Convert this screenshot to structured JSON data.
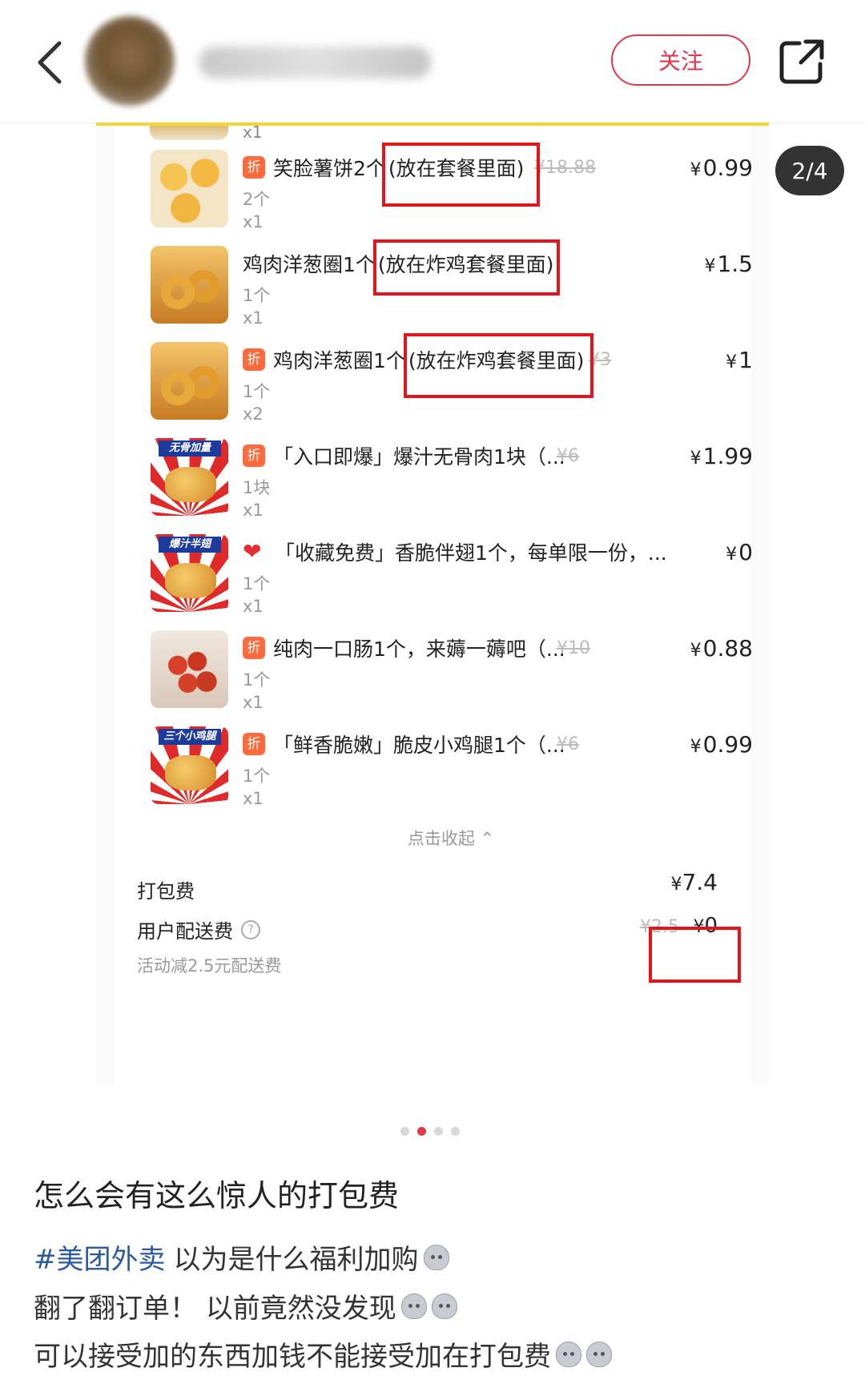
{
  "header": {
    "follow_label": "关注",
    "page_counter": "2/4"
  },
  "order": {
    "top_partial_qty": "x1",
    "items": [
      {
        "badge": "折",
        "name": "笑脸薯饼2个",
        "note": "(放在套餐里面)",
        "spec": "2个",
        "qty": "x1",
        "orig_price": "¥18.88",
        "price": "0.99"
      },
      {
        "badge": "",
        "name": "鸡肉洋葱圈1个",
        "note": "(放在炸鸡套餐里面)",
        "spec": "1个",
        "qty": "x1",
        "orig_price": "",
        "price": "1.5"
      },
      {
        "badge": "折",
        "name": "鸡肉洋葱圈1个",
        "note": "(放在炸鸡套餐里面)",
        "spec": "1个",
        "qty": "x2",
        "orig_price": "¥3",
        "price": "1"
      },
      {
        "badge": "折",
        "name": "「入口即爆」爆汁无骨肉1块（...",
        "note": "",
        "spec": "1块",
        "qty": "x1",
        "orig_price": "¥6",
        "price": "1.99",
        "thumb_tag": "无骨加量"
      },
      {
        "badge": "heart",
        "name": "「收藏免费」香脆伴翅1个，每单限一份，...",
        "note": "",
        "spec": "1个",
        "qty": "x1",
        "orig_price": "",
        "price": "0",
        "thumb_tag": "爆汁半翅"
      },
      {
        "badge": "折",
        "name": "纯肉一口肠1个，来薅一薅吧（...",
        "note": "",
        "spec": "1个",
        "qty": "x1",
        "orig_price": "¥10",
        "price": "0.88"
      },
      {
        "badge": "折",
        "name": "「鲜香脆嫩」脆皮小鸡腿1个（...",
        "note": "",
        "spec": "1个",
        "qty": "x1",
        "orig_price": "¥6",
        "price": "0.99",
        "thumb_tag": "三个小鸡腿"
      }
    ],
    "currency": "¥",
    "collapse_label": "点击收起 ⌃",
    "packing_fee_label": "打包费",
    "packing_fee": "7.4",
    "delivery_fee_label": "用户配送费",
    "delivery_fee_orig": "¥2.5",
    "delivery_fee": "0",
    "delivery_note": "活动减2.5元配送费"
  },
  "post": {
    "title": "怎么会有这么惊人的打包费",
    "hashtag": "#美团外卖",
    "line1": "以为是什么福利加购",
    "line2": "翻了翻订单！ 以前竟然没发现",
    "line3": "可以接受加的东西加钱不能接受加在打包费"
  },
  "colors": {
    "accent": "#e5364b",
    "highlight_box": "#e5141b",
    "discount_badge": "#ff6a3d",
    "hashtag": "#2b5a9e"
  }
}
